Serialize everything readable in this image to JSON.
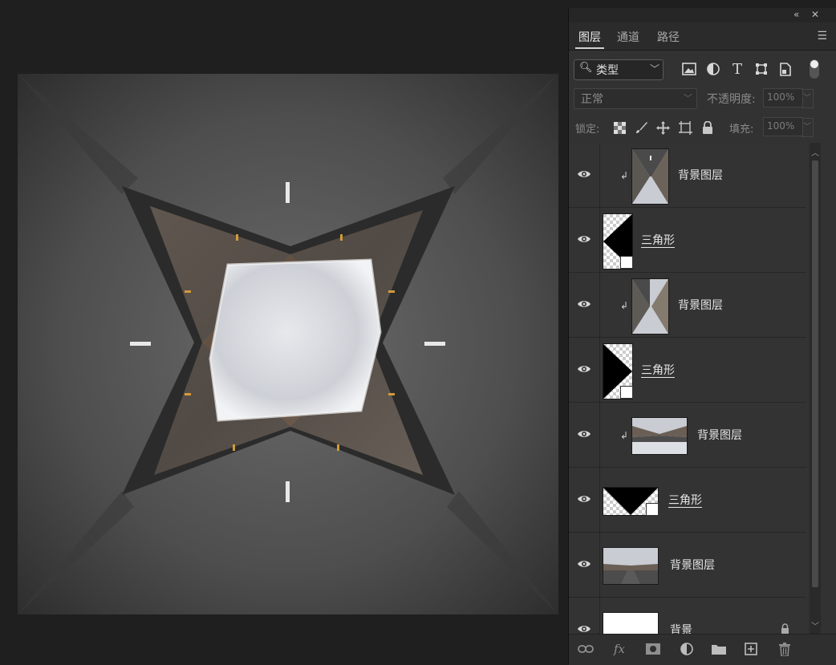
{
  "panel": {
    "collapse_glyph": "«",
    "close_glyph": "✕",
    "tabs": [
      {
        "label": "图层",
        "active": true
      },
      {
        "label": "通道",
        "active": false
      },
      {
        "label": "路径",
        "active": false
      }
    ],
    "menu_icon": "hamburger-menu-icon"
  },
  "filter": {
    "type_label": "类型",
    "icons": [
      "image-filter-icon",
      "adjustment-filter-icon",
      "type-filter-icon",
      "shape-filter-icon",
      "smart-object-filter-icon"
    ],
    "toggle": "on"
  },
  "blend": {
    "mode": "正常",
    "opacity_label": "不透明度:",
    "opacity_value": "100%"
  },
  "lock": {
    "label": "锁定:",
    "icons": [
      "lock-transparent-pixels-icon",
      "lock-image-pixels-icon",
      "lock-position-icon",
      "lock-artboard-icon",
      "lock-all-icon"
    ],
    "fill_label": "填充:",
    "fill_value": "100%"
  },
  "layers": [
    {
      "name": "背景图层",
      "kind": "clipped-image",
      "thumb": "road-vertical-left"
    },
    {
      "name": "三角形",
      "kind": "shape",
      "thumb": "triangle-left"
    },
    {
      "name": "背景图层",
      "kind": "clipped-image",
      "thumb": "road-vertical-right"
    },
    {
      "name": "三角形",
      "kind": "shape",
      "thumb": "triangle-right"
    },
    {
      "name": "背景图层",
      "kind": "clipped-image",
      "thumb": "road-horizontal"
    },
    {
      "name": "三角形",
      "kind": "shape",
      "thumb": "triangle-down"
    },
    {
      "name": "背景图层",
      "kind": "image",
      "thumb": "road-horizontal"
    },
    {
      "name": "背景",
      "kind": "background",
      "thumb": "white",
      "locked": true
    }
  ],
  "bottom_icons": [
    "link-layers-icon",
    "layer-style-fx-icon",
    "add-mask-icon",
    "new-adjustment-layer-icon",
    "new-group-folder-icon",
    "new-layer-icon",
    "delete-layer-trash-icon"
  ],
  "bottom_fx_label": "fx",
  "colors": {
    "app_bg": "#1f1f1f",
    "panel_bg": "#323232",
    "text": "#e6e6e6",
    "dim_text": "#8a8a8a"
  }
}
